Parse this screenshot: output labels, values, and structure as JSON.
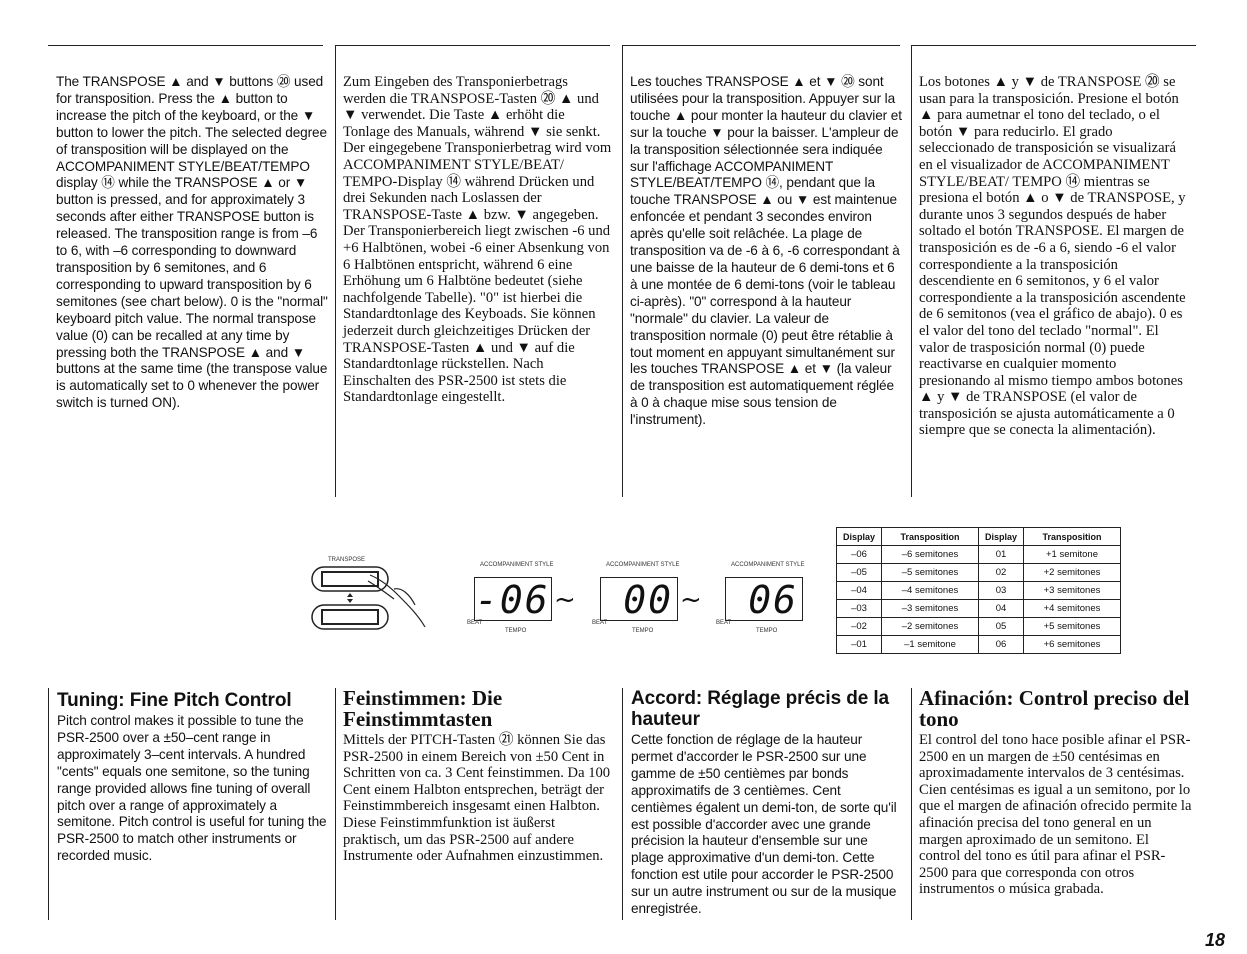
{
  "top": {
    "en": "The TRANSPOSE ▲ and ▼ buttons ⑳ used for transposition. Press the ▲ button to increase the pitch of the keyboard, or the ▼ button to lower the pitch. The selected degree of transposition will be displayed on the ACCOMPANIMENT STYLE/BEAT/TEMPO display ⑭ while the TRANSPOSE ▲ or ▼ button is pressed, and for approximately 3 seconds after either TRANSPOSE button is released. The transposition range is from –6 to 6, with –6 corresponding to downward transposition by 6 semitones, and 6 corresponding to upward transposition by 6 semitones (see chart below). 0 is the \"normal\" keyboard pitch value. The normal transpose value (0) can be recalled at any time by pressing both the TRANSPOSE ▲ and ▼ buttons at the same time (the transpose value is automatically set to 0 whenever the power switch is turned ON).",
    "de": "Zum Eingeben des Transponierbetrags werden die TRANSPOSE-Tasten ⑳ ▲ und ▼ verwendet. Die Taste ▲ erhöht die Tonlage des Manuals, während ▼ sie senkt. Der eingegebene Transponierbetrag wird vom ACCOMPANIMENT STYLE/BEAT/ TEMPO-Display ⑭ während Drücken und drei Sekunden nach Loslassen der TRANSPOSE-Taste ▲ bzw. ▼ angegeben. Der Transponierbereich liegt zwischen -6 und +6 Halbtönen, wobei -6 einer Absenkung von 6 Halbtönen entspricht, während 6 eine Erhöhung um 6 Halbtöne bedeutet (siehe nachfolgende Tabelle). \"0\" ist hierbei die Standardtonlage des Keyboads. Sie können jederzeit durch gleichzeitiges Drücken der TRANSPOSE-Tasten ▲ und ▼ auf die Standardtonlage rückstellen. Nach Einschalten des PSR-2500 ist stets die Standardtonlage eingestellt.",
    "fr": "Les touches TRANSPOSE ▲ et ▼ ⑳ sont utilisées pour la transposition. Appuyer sur la touche ▲ pour monter la hauteur du clavier et sur la touche ▼ pour la baisser. L'ampleur de la transposition sélectionnée sera indiquée sur l'affichage ACCOMPANIMENT STYLE/BEAT/TEMPO ⑭, pendant que la touche TRANSPOSE ▲ ou ▼ est maintenue enfoncée et pendant 3 secondes environ après qu'elle soit relâchée. La plage de transposition va de -6 à 6, -6 correspondant à une baisse de la hauteur de 6 demi-tons et 6 à une montée de 6 demi-tons (voir le tableau ci-après). \"0\" correspond à la hauteur \"normale\" du clavier. La valeur de transposition normale (0) peut être rétablie à tout moment en appuyant simultanément sur les touches TRANSPOSE ▲ et ▼ (la valeur de transposition est automatiquement réglée à 0 à chaque mise sous tension de l'instrument).",
    "es": "Los botones ▲ y ▼ de TRANSPOSE ⑳ se usan para la transposición. Presione el botón ▲ para aumetnar el tono del teclado, o el botón ▼ para reducirlo. El grado seleccionado de transposición se visualizará en el visualizador de ACCOMPANIMENT STYLE/BEAT/ TEMPO ⑭ mientras se presiona el botón ▲ o ▼ de TRANSPOSE, y durante unos 3 segundos después de haber soltado el botón TRANSPOSE. El margen de transposición es de -6 a 6, siendo -6 el valor correspondiente a la transposición descendiente en 6 semitonos, y 6 el valor correspondiente a la transposición ascendente de 6 semitonos (vea el gráfico de abajo). 0 es el valor del tono del teclado \"normal\". El valor de trasposición normal (0) puede reactivarse en cualquier momento presionando al mismo tiempo ambos botones ▲ y ▼ de TRANSPOSE (el valor de transposición se ajusta automáticamente a 0 siempre que se conecta la alimentación)."
  },
  "figure": {
    "transpose_label": "TRANSPOSE",
    "style_label": "ACCOMPANIMENT STYLE",
    "beat_label": "BEAT",
    "tempo_label": "TEMPO",
    "displays": [
      "-06",
      "00",
      "06"
    ],
    "separator": "~"
  },
  "table": {
    "headers": [
      "Display",
      "Transposition",
      "Display",
      "Transposition"
    ],
    "rows": [
      [
        "–06",
        "–6  semitones",
        "01",
        "+1  semitone"
      ],
      [
        "–05",
        "–5  semitones",
        "02",
        "+2  semitones"
      ],
      [
        "–04",
        "–4  semitones",
        "03",
        "+3  semitones"
      ],
      [
        "–03",
        "–3  semitones",
        "04",
        "+4  semitones"
      ],
      [
        "–02",
        "–2  semitones",
        "05",
        "+5  semitones"
      ],
      [
        "–01",
        "–1  semitone",
        "06",
        "+6  semitones"
      ]
    ]
  },
  "bottom": {
    "en": {
      "title": "Tuning: Fine Pitch Control",
      "body": "Pitch control makes it possible to tune the PSR-2500 over a ±50–cent range in approximately 3–cent intervals. A hundred \"cents\" equals one semitone, so the tuning range provided allows fine tuning of overall pitch over a range of approximately a semitone. Pitch control is useful for tuning the PSR-2500 to match other instruments or recorded music."
    },
    "de": {
      "title": "Feinstimmen: Die Feinstimmtasten",
      "body": "Mittels der PITCH-Tasten ㉑ können Sie das PSR-2500 in einem Bereich von ±50 Cent in Schritten von ca. 3 Cent feinstimmen. Da 100 Cent einem Halbton entsprechen, beträgt der Feinstimmbereich insgesamt einen Halbton. Diese Feinstimmfunktion ist äußerst praktisch, um das PSR-2500 auf andere Instrumente oder Aufnahmen einzustimmen."
    },
    "fr": {
      "title": "Accord: Réglage précis de la hauteur",
      "body": "Cette fonction de réglage de la hauteur permet d'accorder le PSR-2500 sur une gamme de ±50 centièmes par bonds approximatifs de 3 centièmes. Cent centièmes égalent un demi-ton, de sorte qu'il est possible d'accorder avec une grande précision la hauteur d'ensemble sur une plage approximative d'un demi-ton. Cette fonction est utile pour accorder le PSR-2500 sur un autre instrument ou sur de la musique enregistrée."
    },
    "es": {
      "title": "Afinación: Control preciso del tono",
      "body": "El control del tono hace posible afinar el PSR-2500 en un margen de ±50 centésimas en aproximadamente intervalos de 3 centésimas. Cien centésimas es igual a un semitono, por lo que el margen de afinación ofrecido permite la afinación precisa del tono general en un margen aproximado de un semitono. El control del tono es útil para afinar el PSR-2500 para que corresponda con otros instrumentos o música grabada."
    }
  },
  "page_number": "18"
}
